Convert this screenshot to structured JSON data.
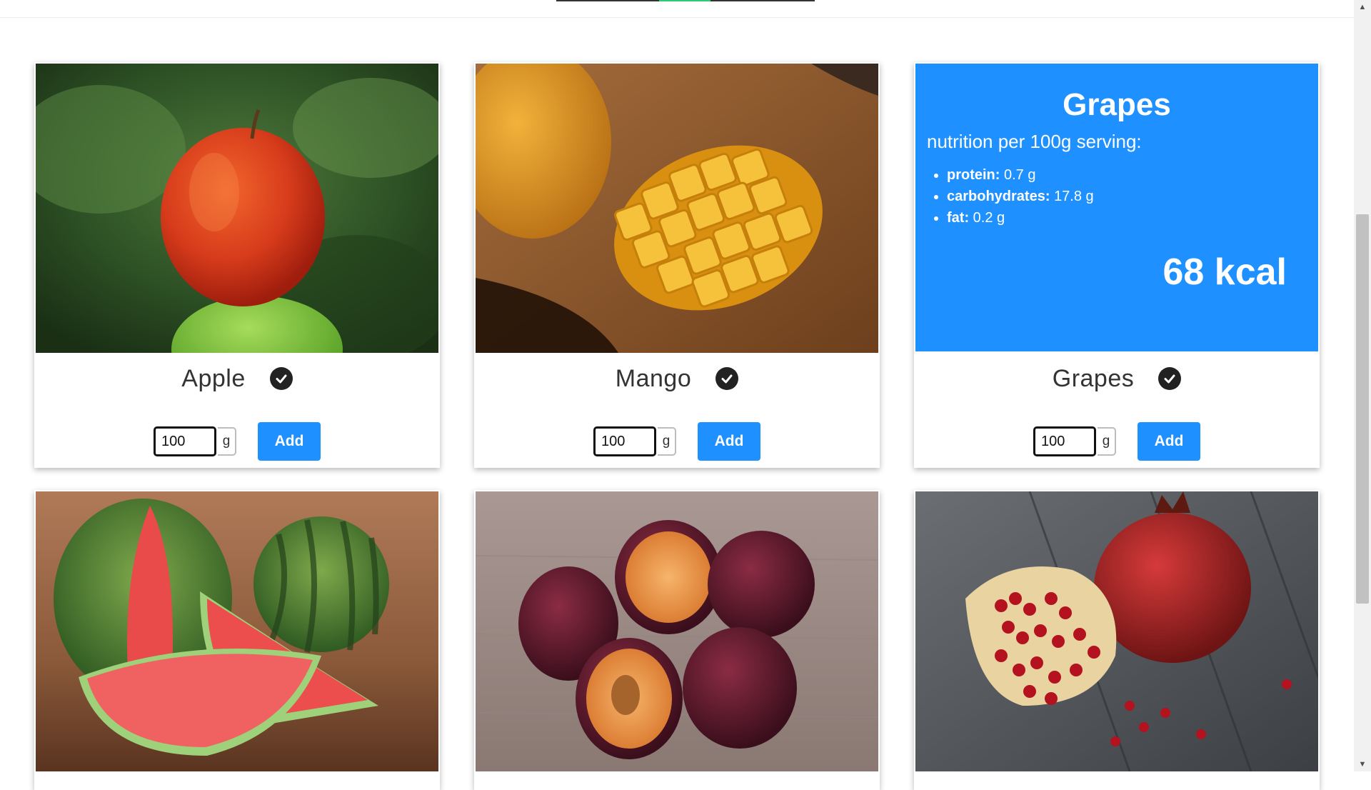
{
  "colors": {
    "accent": "#1e90ff",
    "nav_dark": "#333333",
    "nav_active": "#2ecc71",
    "check": "#222222"
  },
  "cards": [
    {
      "name": "Apple",
      "quantity": "100",
      "unit": "g",
      "add_label": "Add",
      "image": "apple-photo"
    },
    {
      "name": "Mango",
      "quantity": "100",
      "unit": "g",
      "add_label": "Add",
      "image": "mango-photo"
    },
    {
      "name": "Grapes",
      "quantity": "100",
      "unit": "g",
      "add_label": "Add",
      "nutrition": {
        "title": "Grapes",
        "subtitle": "nutrition per 100g serving:",
        "items": [
          {
            "label": "protein:",
            "value": "0.7 g"
          },
          {
            "label": "carbohydrates:",
            "value": "17.8 g"
          },
          {
            "label": "fat:",
            "value": "0.2 g"
          }
        ],
        "kcal": "68 kcal"
      }
    },
    {
      "image": "watermelon-photo"
    },
    {
      "image": "plums-photo"
    },
    {
      "image": "pomegranate-photo"
    }
  ],
  "icons": {
    "check": "check-circle-icon",
    "scroll_up": "scroll-up-arrow-icon",
    "scroll_down": "scroll-down-arrow-icon"
  }
}
